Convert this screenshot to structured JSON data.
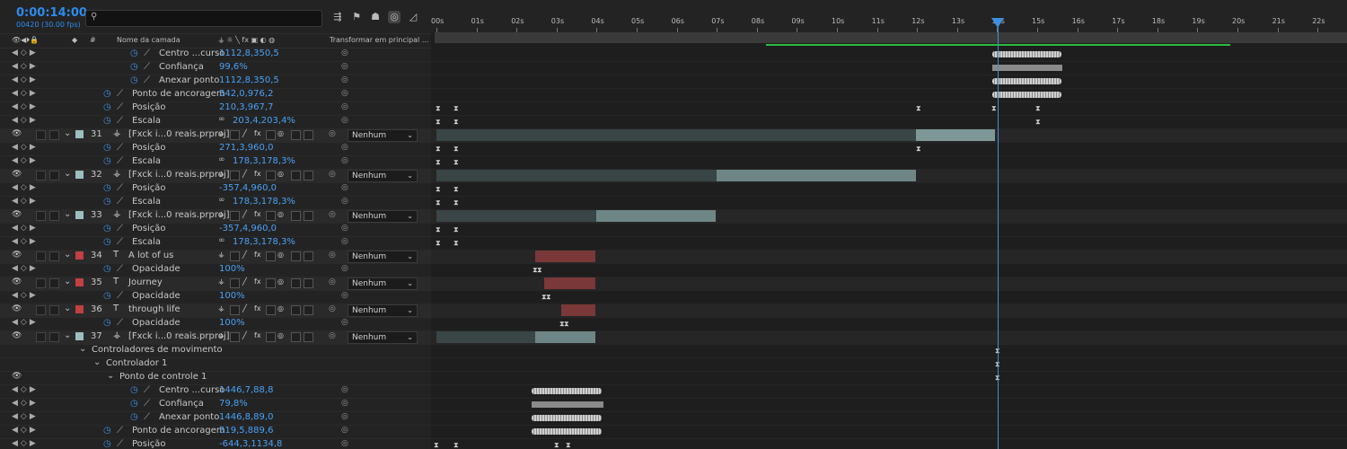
{
  "timecode": "0:00:14:00",
  "frames_fps": "00420 (30.00 fps)",
  "search": {
    "placeholder": "",
    "icon": "search-icon"
  },
  "columns": {
    "name": "Nome da camada",
    "hash": "#",
    "parent": "Transformar em principal ..."
  },
  "ruler_labels": [
    "00s",
    "01s",
    "02s",
    "03s",
    "04s",
    "05s",
    "06s",
    "07s",
    "08s",
    "09s",
    "10s",
    "11s",
    "12s",
    "13s",
    "14s",
    "15s",
    "16s",
    "17s",
    "18s",
    "19s",
    "20s",
    "21s",
    "22s"
  ],
  "parent_option": "Nenhum",
  "rows": [
    {
      "kind": "prop",
      "indent": 3,
      "name": "Centro ...curso",
      "value": "1112,8,350,5"
    },
    {
      "kind": "prop",
      "indent": 3,
      "name": "Confiança",
      "value": "99,6%"
    },
    {
      "kind": "prop",
      "indent": 3,
      "name": "Anexar ponto",
      "value": "1112,8,350,5"
    },
    {
      "kind": "prop",
      "indent": 1,
      "name": "Ponto de ancoragem",
      "value": "542,0,976,2"
    },
    {
      "kind": "prop",
      "indent": 1,
      "name": "Posição",
      "value": "210,3,967,7"
    },
    {
      "kind": "prop",
      "indent": 1,
      "name": "Escala",
      "value": "203,4,203,4%",
      "link": true
    },
    {
      "kind": "layer",
      "num": "31",
      "name": "[Fxck i...0 reais.prproj]",
      "type": "comp",
      "color": "#9bbfc0"
    },
    {
      "kind": "prop",
      "indent": 1,
      "name": "Posição",
      "value": "271,3,960,0"
    },
    {
      "kind": "prop",
      "indent": 1,
      "name": "Escala",
      "value": "178,3,178,3%",
      "link": true
    },
    {
      "kind": "layer",
      "num": "32",
      "name": "[Fxck i...0 reais.prproj]",
      "type": "comp",
      "color": "#9bbfc0"
    },
    {
      "kind": "prop",
      "indent": 1,
      "name": "Posição",
      "value": "-357,4,960,0"
    },
    {
      "kind": "prop",
      "indent": 1,
      "name": "Escala",
      "value": "178,3,178,3%",
      "link": true
    },
    {
      "kind": "layer",
      "num": "33",
      "name": "[Fxck i...0 reais.prproj]",
      "type": "comp",
      "color": "#9bbfc0"
    },
    {
      "kind": "prop",
      "indent": 1,
      "name": "Posição",
      "value": "-357,4,960,0"
    },
    {
      "kind": "prop",
      "indent": 1,
      "name": "Escala",
      "value": "178,3,178,3%",
      "link": true
    },
    {
      "kind": "layer",
      "num": "34",
      "name": "A lot of us",
      "type": "text",
      "color": "#c24040"
    },
    {
      "kind": "prop",
      "indent": 1,
      "name": "Opacidade",
      "value": "100%"
    },
    {
      "kind": "layer",
      "num": "35",
      "name": "Journey",
      "type": "text",
      "color": "#c24040"
    },
    {
      "kind": "prop",
      "indent": 1,
      "name": "Opacidade",
      "value": "100%"
    },
    {
      "kind": "layer",
      "num": "36",
      "name": "through life",
      "type": "text",
      "color": "#c24040"
    },
    {
      "kind": "prop",
      "indent": 1,
      "name": "Opacidade",
      "value": "100%"
    },
    {
      "kind": "layer",
      "num": "37",
      "name": "[Fxck i...0 reais.prproj]",
      "type": "comp",
      "color": "#9bbfc0"
    },
    {
      "kind": "group",
      "indent": 0,
      "name": "Controladores de movimento"
    },
    {
      "kind": "group",
      "indent": 1,
      "name": "Controlador 1"
    },
    {
      "kind": "group",
      "indent": 2,
      "name": "Ponto de controle 1"
    },
    {
      "kind": "prop",
      "indent": 3,
      "name": "Centro ...curso",
      "value": "1446,7,88,8"
    },
    {
      "kind": "prop",
      "indent": 3,
      "name": "Confiança",
      "value": "79,8%"
    },
    {
      "kind": "prop",
      "indent": 3,
      "name": "Anexar ponto",
      "value": "1446,8,89,0"
    },
    {
      "kind": "prop",
      "indent": 1,
      "name": "Ponto de ancoragem",
      "value": "519,5,889,6"
    },
    {
      "kind": "prop",
      "indent": 1,
      "name": "Posição",
      "value": "-644,3,1134,8"
    }
  ]
}
